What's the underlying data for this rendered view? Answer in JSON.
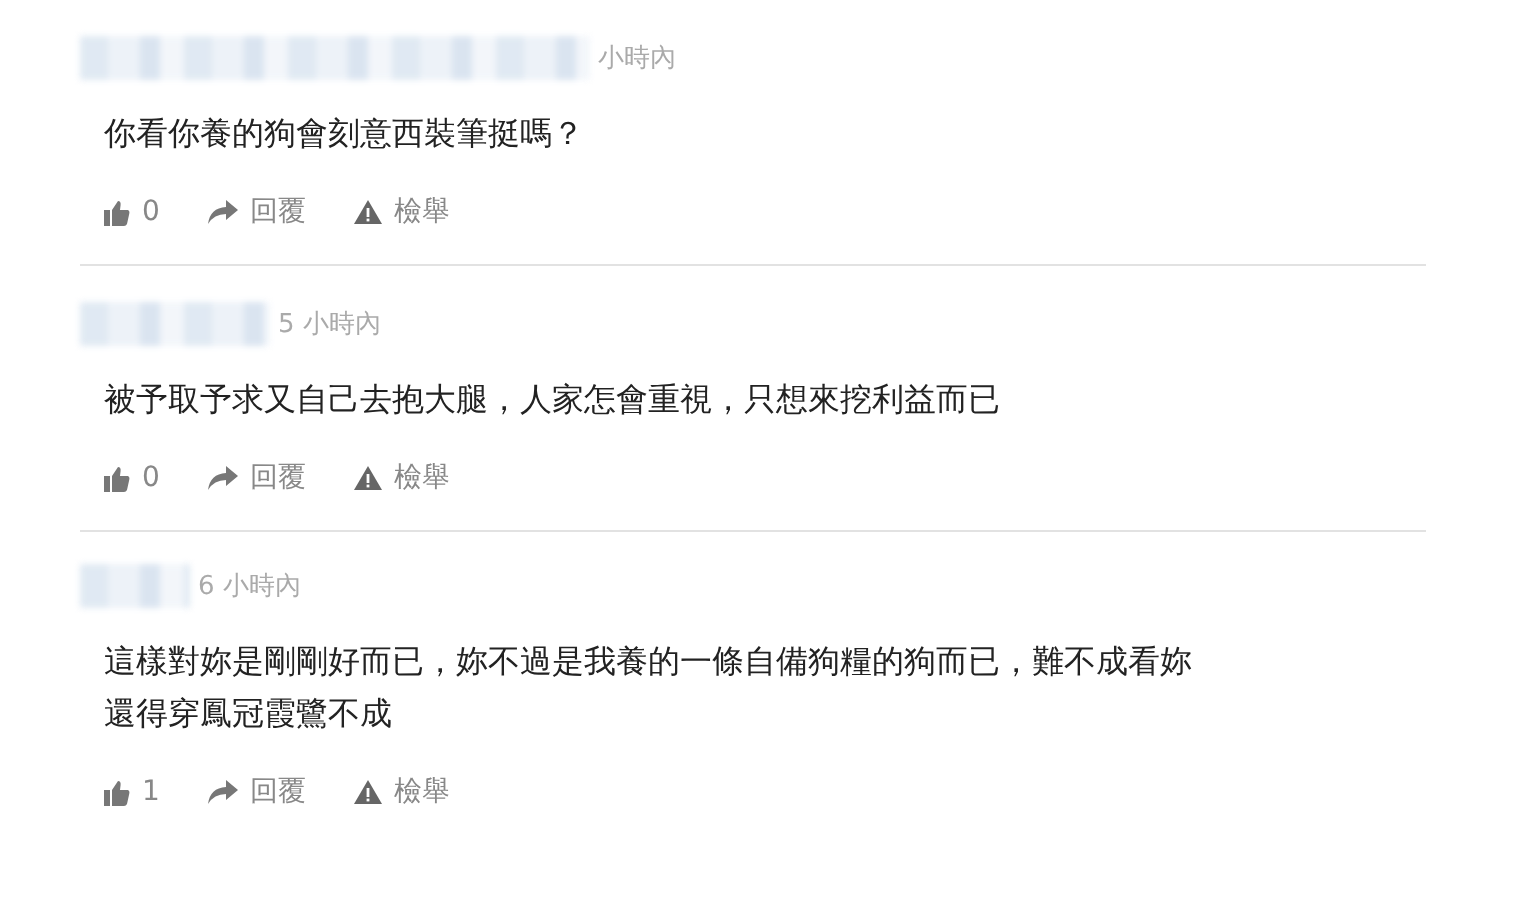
{
  "comments": [
    {
      "time": "小時內",
      "lines": [
        "你看你養的狗會刻意西裝筆挺嗎？"
      ],
      "likes": "0",
      "reply": "回覆",
      "report": "檢舉"
    },
    {
      "time": "5 小時內",
      "lines": [
        "被予取予求又自己去抱大腿，人家怎會重視，只想來挖利益而已"
      ],
      "likes": "0",
      "reply": "回覆",
      "report": "檢舉"
    },
    {
      "time": "6 小時內",
      "lines": [
        "這樣對妳是剛剛好而已，妳不過是我養的一條自備狗糧的狗而已，難不成看妳",
        "還得穿鳳冠霞鷺不成"
      ],
      "likes": "1",
      "reply": "回覆",
      "report": "檢舉"
    }
  ]
}
